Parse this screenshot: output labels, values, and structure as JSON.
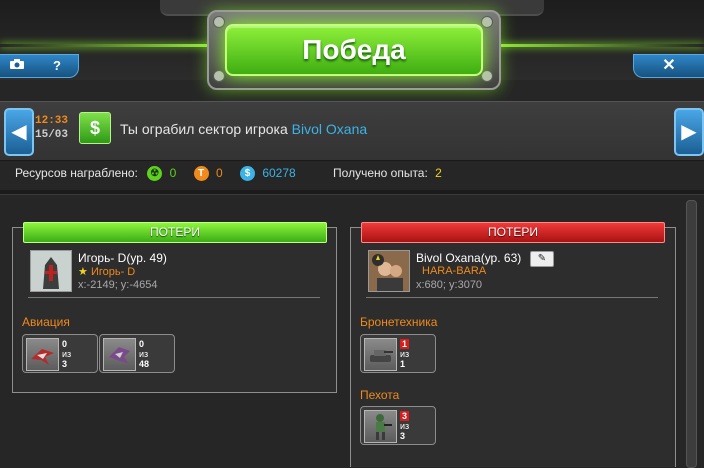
{
  "window": {
    "title": "Победа",
    "close_label": "✕",
    "camera_icon": "camera-icon",
    "help_label": "?"
  },
  "message": {
    "time": "12:33",
    "date": "15/03",
    "icon": "money-icon",
    "text_prefix": "Ты ограбил сектор игрока",
    "player": "Bivol Oxana"
  },
  "resources": {
    "label": "Ресурсов награблено:",
    "radiation": "0",
    "titanium": "0",
    "credits": "60278",
    "exp_label": "Получено опыта:",
    "exp": "2"
  },
  "left_panel": {
    "header": "ПОТЕРИ",
    "player_name": "Игорь- D(ур. 49)",
    "alliance": "Игорь- D",
    "coords": "x:-2149; y:-4654",
    "category": "Авиация",
    "units": [
      {
        "lost": "0",
        "of_label": "из",
        "total": "3"
      },
      {
        "lost": "0",
        "of_label": "из",
        "total": "48"
      }
    ]
  },
  "right_panel": {
    "header": "ПОТЕРИ",
    "player_name": "Bivol Oxana(ур. 63)",
    "alliance": "HARA-BARA",
    "coords": "x:680; y:3070",
    "categories": [
      {
        "name": "Бронетехника",
        "units": [
          {
            "lost": "1",
            "of_label": "из",
            "total": "1"
          }
        ]
      },
      {
        "name": "Пехота",
        "units": [
          {
            "lost": "3",
            "of_label": "из",
            "total": "3"
          }
        ]
      }
    ]
  },
  "colors": {
    "accent_green": "#5fd21f",
    "accent_red": "#d81d1d",
    "accent_orange": "#f08a1c",
    "link_blue": "#3bb3e8",
    "exp_yellow": "#f0d21c"
  }
}
